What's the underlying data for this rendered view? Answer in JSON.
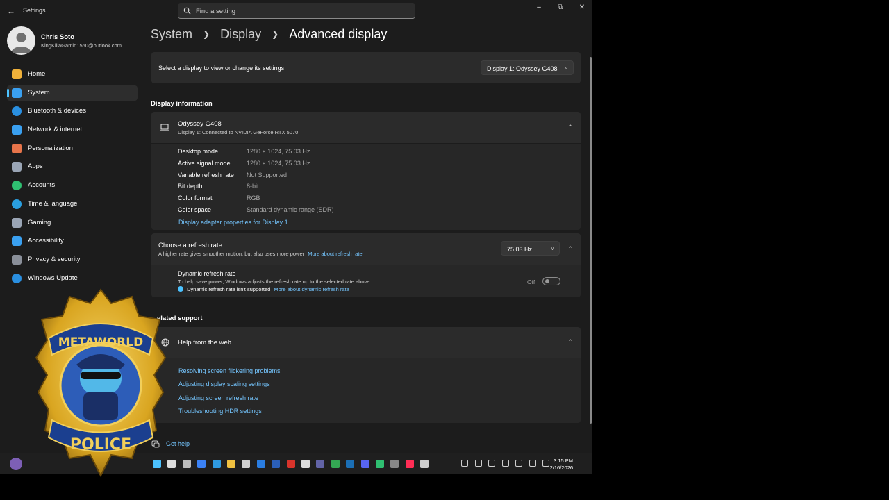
{
  "window": {
    "app_title": "Settings",
    "search_placeholder": "Find a setting",
    "controls": [
      "minimize",
      "maximize",
      "close"
    ]
  },
  "profile": {
    "name": "Chris Soto",
    "email": "KingKillaGamin1560@outlook.com"
  },
  "sidebar": {
    "items": [
      {
        "label": "Home",
        "icon": "home-icon",
        "color": "#f0b13a",
        "active": false
      },
      {
        "label": "System",
        "icon": "system-icon",
        "color": "#3aa0f0",
        "active": true
      },
      {
        "label": "Bluetooth & devices",
        "icon": "bluetooth-icon",
        "color": "#2a8fe0",
        "active": false
      },
      {
        "label": "Network & internet",
        "icon": "wifi-icon",
        "color": "#3aa0f0",
        "active": false
      },
      {
        "label": "Personalization",
        "icon": "brush-icon",
        "color": "#e7744a",
        "active": false
      },
      {
        "label": "Apps",
        "icon": "apps-icon",
        "color": "#9aa5b5",
        "active": false
      },
      {
        "label": "Accounts",
        "icon": "accounts-icon",
        "color": "#2fbf71",
        "active": false
      },
      {
        "label": "Time & language",
        "icon": "globe-icon",
        "color": "#2a9fe0",
        "active": false
      },
      {
        "label": "Gaming",
        "icon": "gamepad-icon",
        "color": "#9aa5b5",
        "active": false
      },
      {
        "label": "Accessibility",
        "icon": "accessibility-icon",
        "color": "#3aa0f0",
        "active": false
      },
      {
        "label": "Privacy & security",
        "icon": "shield-icon",
        "color": "#8a8f99",
        "active": false
      },
      {
        "label": "Windows Update",
        "icon": "update-icon",
        "color": "#2a8fe0",
        "active": false
      }
    ]
  },
  "breadcrumb": {
    "items": [
      "System",
      "Display"
    ],
    "current": "Advanced display"
  },
  "display_select": {
    "label": "Select a display to view or change its settings",
    "value": "Display 1: Odyssey G408"
  },
  "display_info": {
    "section_title": "Display information",
    "monitor_name": "Odyssey G408",
    "monitor_subtitle": "Display 1: Connected to NVIDIA GeForce RTX 5070",
    "rows": [
      {
        "label": "Desktop mode",
        "value": "1280 × 1024, 75.03 Hz"
      },
      {
        "label": "Active signal mode",
        "value": "1280 × 1024, 75.03 Hz"
      },
      {
        "label": "Variable refresh rate",
        "value": "Not Supported"
      },
      {
        "label": "Bit depth",
        "value": "8-bit"
      },
      {
        "label": "Color format",
        "value": "RGB"
      },
      {
        "label": "Color space",
        "value": "Standard dynamic range (SDR)"
      }
    ],
    "adapter_link": "Display adapter properties for Display 1"
  },
  "refresh_rate": {
    "title": "Choose a refresh rate",
    "description": "A higher rate gives smoother motion, but also uses more power",
    "more_link": "More about refresh rate",
    "value": "75.03 Hz",
    "dynamic": {
      "title": "Dynamic refresh rate",
      "description": "To help save power, Windows adjusts the refresh rate up to the selected rate above",
      "note": "Dynamic refresh rate isn't supported",
      "more_link": "More about dynamic refresh rate",
      "toggle_label": "Off",
      "toggle_on": false
    }
  },
  "related_support": {
    "section_title": "elated support",
    "help_title": "Help from the web",
    "links": [
      "Resolving screen flickering problems",
      "Adjusting display scaling settings",
      "Adjusting screen refresh rate",
      "Troubleshooting HDR settings"
    ],
    "get_help": "Get help"
  },
  "badge": {
    "top_text": "METAWORLD",
    "bottom_text": "POLICE",
    "colors": {
      "gold": "#d9a520",
      "blue": "#1f4fa8",
      "red_banner": "#1b3f8f"
    }
  },
  "taskbar": {
    "time": "3:15 PM",
    "date": "2/16/2026",
    "pinned_icons": [
      "start-icon",
      "search-icon",
      "task-view-icon",
      "copilot-icon",
      "edge-icon",
      "explorer-icon",
      "store-icon",
      "outlook-icon",
      "word-icon",
      "acrobat-icon",
      "capcut-icon",
      "teams-icon",
      "chrome-icon",
      "steam-icon",
      "discord-icon",
      "xbox-icon",
      "obs-icon",
      "tiktok-icon",
      "settings-icon"
    ],
    "tray_icons": [
      "chevron-up-icon",
      "sync-icon",
      "onedrive-icon",
      "mic-icon",
      "network-icon",
      "volume-icon",
      "notification-icon"
    ]
  }
}
